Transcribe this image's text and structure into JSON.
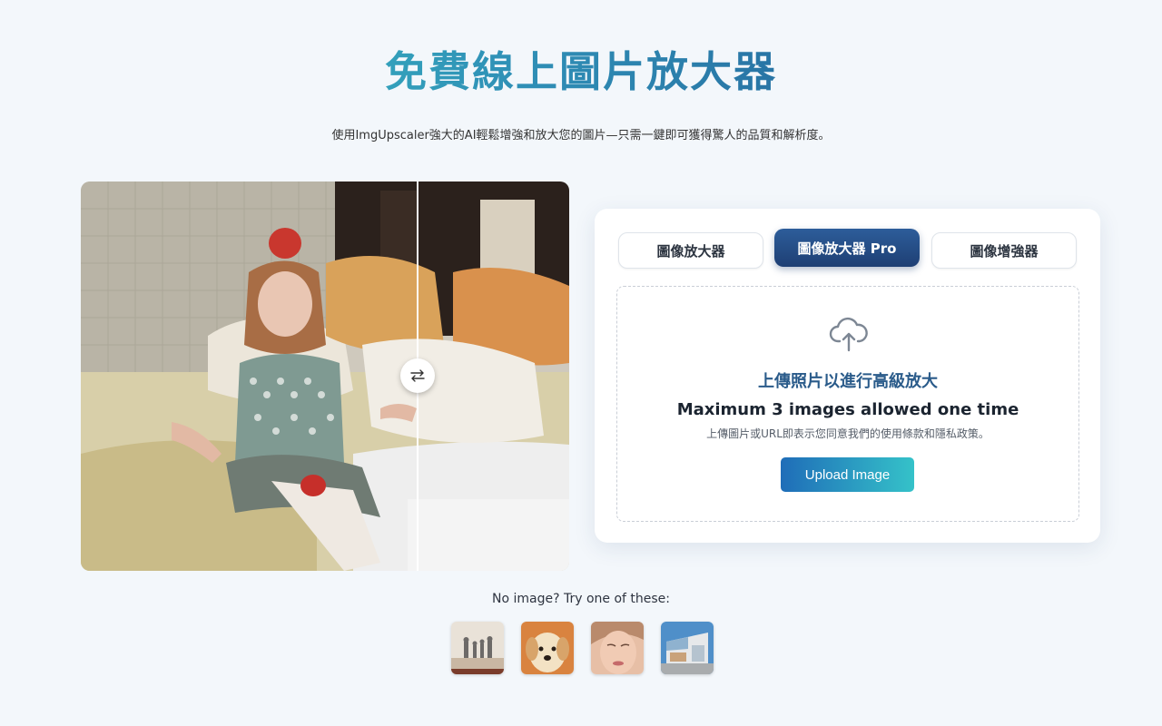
{
  "header": {
    "title": "免費線上圖片放大器",
    "subtitle": "使用ImgUpscaler強大的AI輕鬆增強和放大您的圖片—只需一鍵即可獲得驚人的品質和解析度。"
  },
  "preview": {
    "compare_icon": "swap-arrows-icon"
  },
  "card": {
    "tabs": [
      {
        "label": "圖像放大器",
        "active": false
      },
      {
        "label": "圖像放大器 Pro",
        "active": true
      },
      {
        "label": "圖像增強器",
        "active": false
      }
    ],
    "dropzone": {
      "icon": "cloud-upload-icon",
      "title": "上傳照片以進行高級放大",
      "limit": "Maximum 3 images allowed one time",
      "note": "上傳圖片或URL即表示您同意我們的使用條款和隱私政策。",
      "button_label": "Upload Image"
    }
  },
  "samples": {
    "label": "No image? Try one of these:",
    "items": [
      {
        "name": "family-beach-thumbnail"
      },
      {
        "name": "puppy-thumbnail"
      },
      {
        "name": "woman-portrait-thumbnail"
      },
      {
        "name": "building-thumbnail"
      }
    ]
  },
  "colors": {
    "accent": "#1e3f74",
    "teal": "#35c2c9",
    "background": "#f3f7fb"
  }
}
